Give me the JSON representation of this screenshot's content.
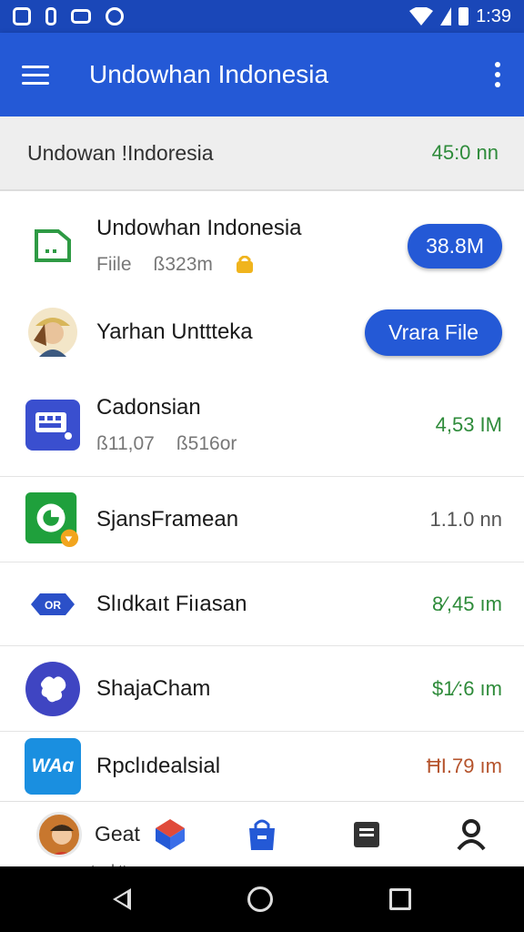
{
  "status_bar": {
    "time": "1:39",
    "icons": [
      "sim-icon",
      "notification-icon",
      "voicemail-icon",
      "sync-icon",
      "wifi-icon",
      "signal-icon",
      "battery-icon"
    ]
  },
  "app_bar": {
    "title": "Undowhan Indonesia",
    "menu_icon": "hamburger-icon",
    "overflow_icon": "more-vert-icon"
  },
  "summary": {
    "title": "Undowan !Indoresia",
    "value": "45:0 nn"
  },
  "rows": [
    {
      "title": "Undowhan Indonesia",
      "sub1": "Fiile",
      "sub2": "ß323m",
      "badge": "38.8M",
      "icon": "document-icon"
    },
    {
      "title": "Yarhan Unttteka",
      "button": "Vrara File",
      "icon": "avatar-icon"
    },
    {
      "title": "Cadonsian",
      "sub1": "ß11,07",
      "sub2": "ß516or",
      "value": "4,53 IM",
      "icon": "keyboard-icon"
    },
    {
      "title": "SjansFramean",
      "value": "1.1.0 nn",
      "icon": "refresh-app-icon"
    },
    {
      "title": "Slıdkaıt Fiıasan",
      "value": "8⁄,45 ım",
      "icon": "badge-icon"
    },
    {
      "title": "ShajaCham",
      "value": "$1⁄:6 ım",
      "icon": "puzzle-icon"
    },
    {
      "title": "Rpclıdealsial",
      "value": "ĦI.79 ım",
      "icon": "wa-icon",
      "icon_text": "WAɑ"
    }
  ],
  "bottom_nav": {
    "first_label": "Geat",
    "first_sub": "teal:tteras",
    "icons": [
      "cube-icon",
      "shopping-bag-icon",
      "inbox-icon",
      "person-icon"
    ]
  },
  "colors": {
    "primary": "#2459d6",
    "status": "#1a47b8",
    "green": "#2e8b3a",
    "accent_red": "#b5532c"
  }
}
